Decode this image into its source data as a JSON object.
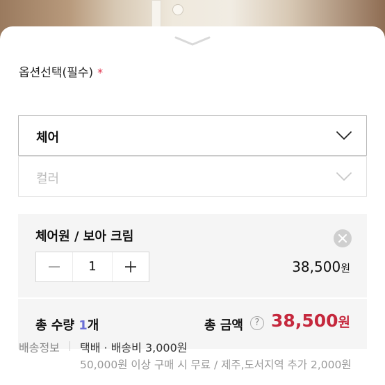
{
  "option_section": {
    "label": "옵션선택(필수)",
    "required_mark": "*"
  },
  "selects": [
    {
      "value": "체어",
      "state": "selected"
    },
    {
      "value": "컬러",
      "state": "disabled-placeholder"
    }
  ],
  "selected_item": {
    "name": "체어원 / 보아 크림",
    "quantity": "1",
    "price": "38,500",
    "currency": "원"
  },
  "total": {
    "qty_prefix": "총 수량 ",
    "qty_value": "1",
    "qty_suffix": "개",
    "amount_label": "총 금액",
    "help_symbol": "?",
    "amount": "38,500",
    "currency": "원"
  },
  "shipping": {
    "label": "배송정보",
    "main": "택배 · 배송비 3,000원",
    "note": "50,000원 이상 구매 시 무료 / 제주,도서지역 추가 2,000원"
  },
  "icons": {
    "handle": "chevron-down-icon",
    "dropdown": "chevron-down-icon",
    "remove": "close-icon",
    "minus": "minus-icon",
    "plus": "plus-icon",
    "help": "help-icon"
  },
  "colors": {
    "required": "#e0314b",
    "total_amount": "#c5283d",
    "qty_number": "#6b6fd6"
  }
}
